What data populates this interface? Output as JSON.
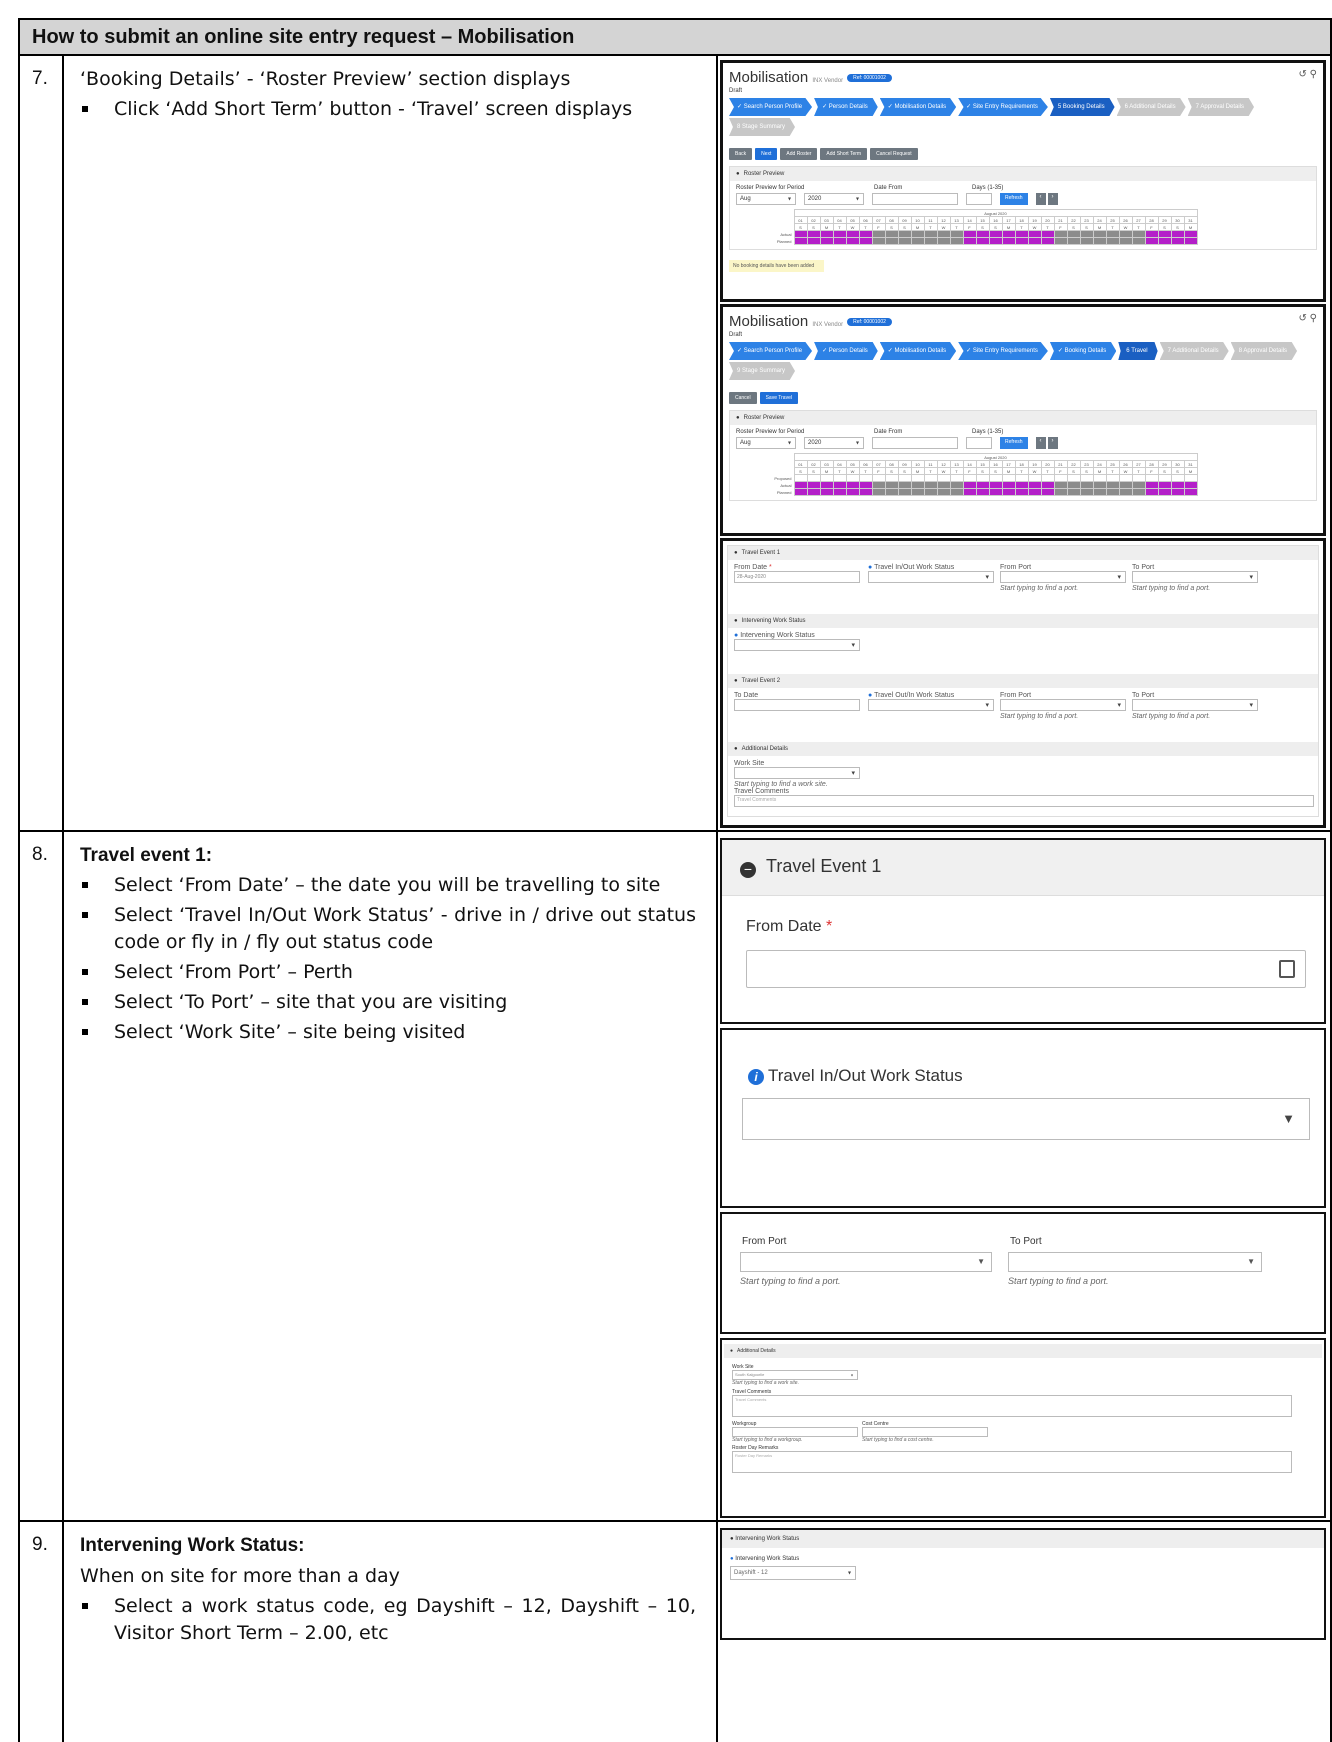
{
  "title": "How to submit an online site entry request – Mobilisation",
  "rows": [
    {
      "num": "7.",
      "intro": "‘Booking Details’ - ‘Roster Preview’ section displays",
      "bullets": [
        "Click ‘Add Short Term’ button - ‘Travel’ screen displays"
      ]
    },
    {
      "num": "8.",
      "heading": "Travel event 1:",
      "bullets": [
        "Select ‘From Date’ – the date you will be travelling to site",
        "Select ‘Travel In/Out Work Status’ - drive in / drive out status code or fly in / fly out status code",
        "Select ‘From Port’ – Perth",
        "Select ‘To Port’ – site that you are visiting",
        "Select ‘Work Site’ – site being visited"
      ]
    },
    {
      "num": "9.",
      "heading": "Intervening Work Status:",
      "intro": "When on site for more than a day",
      "bullets": [
        "Select a work status code, eg Dayshift – 12, Dayshift – 10, Visitor Short Term – 2.00, etc"
      ]
    }
  ],
  "mob": {
    "title": "Mobilisation",
    "vendor": "INX Vendor",
    "ref": "Ref: 00001002",
    "status": "Draft",
    "steps1": [
      "Search Person Profile",
      "Person Details",
      "Mobilisation Details",
      "Site Entry Requirements",
      "Booking Details",
      "Additional Details",
      "Approval Details",
      "Stage Summary"
    ],
    "steps2": [
      "Search Person Profile",
      "Person Details",
      "Mobilisation Details",
      "Site Entry Requirements",
      "Booking Details",
      "Travel",
      "Additional Details",
      "Approval Details",
      "Stage Summary"
    ],
    "buttons1": [
      "Back",
      "Next",
      "Add Roster",
      "Add Short Term",
      "Cancel Request"
    ],
    "buttons2": [
      "Cancel",
      "Save Travel"
    ],
    "roster_panel": "Roster Preview",
    "roster_period": "Roster Preview for Period",
    "date_from": "Date From",
    "days": "Days (1-35)",
    "month": "Aug",
    "year": "2020",
    "refresh": "Refresh",
    "month_label": "August 2020",
    "days_nums": [
      "01",
      "02",
      "03",
      "04",
      "05",
      "06",
      "07",
      "08",
      "09",
      "10",
      "11",
      "12",
      "13",
      "14",
      "15",
      "16",
      "17",
      "18",
      "19",
      "20",
      "21",
      "22",
      "23",
      "24",
      "25",
      "26",
      "27",
      "28",
      "29",
      "30",
      "31"
    ],
    "days_letters": [
      "S",
      "S",
      "M",
      "T",
      "W",
      "T",
      "F",
      "S",
      "S",
      "M",
      "T",
      "W",
      "T",
      "F",
      "S",
      "S",
      "M",
      "T",
      "W",
      "T",
      "F",
      "S",
      "S",
      "M",
      "T",
      "W",
      "T",
      "F",
      "S",
      "S",
      "M"
    ],
    "actual": "Actual",
    "planned": "Planned",
    "proposed": "Proposed",
    "no_booking": "No booking details have been added"
  },
  "travel": {
    "event1": "Travel Event 1",
    "from_date": "From Date",
    "req": "*",
    "from_date_val": "28-Aug-2020",
    "tio": "Travel In/Out Work Status",
    "from_port": "From Port",
    "to_port": "To Port",
    "port_hint": "Start typing to find a port.",
    "interv": "Intervening Work Status",
    "interv_field": "Intervening Work Status",
    "event2": "Travel Event 2",
    "to_date": "To Date",
    "too": "Travel Out/In Work Status",
    "addl": "Additional Details",
    "work_site": "Work Site",
    "ws_hint": "Start typing to find a work site.",
    "comments": "Travel Comments",
    "comments_ph": "Travel Comments",
    "ws_val": "South Kalgoorlie",
    "workgroup": "Workgroup",
    "wg_hint": "Start typing to find a workgroup.",
    "cost_centre": "Cost Centre",
    "cc_hint": "Start typing to find a cost centre.",
    "roster_remarks": "Roster Day Remarks",
    "rr_ph": "Roster Day Remarks",
    "dayshift": "Dayshift - 12"
  }
}
